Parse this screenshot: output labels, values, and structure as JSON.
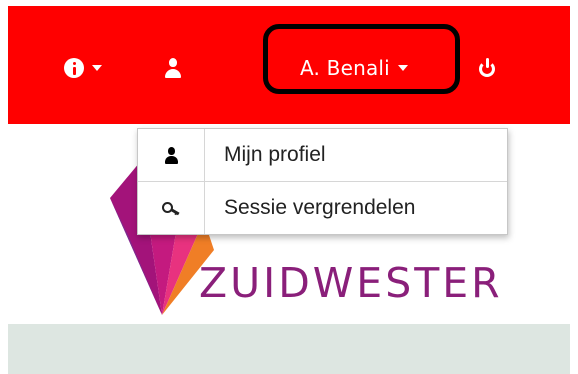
{
  "navbar": {
    "background": "#ff0000",
    "info_icon": "info-circle-icon",
    "user_icon": "user-icon",
    "account_name": "A. Benali",
    "power_icon": "power-icon"
  },
  "highlight": {
    "color": "#000000",
    "target": "account-menu"
  },
  "account_dropdown": {
    "items": [
      {
        "icon": "user-icon",
        "label": "Mijn profiel"
      },
      {
        "icon": "key-icon",
        "label": "Sessie vergrendelen"
      }
    ]
  },
  "logo": {
    "text": "ZUIDWESTER",
    "text_color": "#8a1f7a",
    "accent_colors": [
      "#c0157f",
      "#e8327f",
      "#7e2a8f",
      "#f07e26"
    ]
  },
  "bottom_band": {
    "color": "#dde6e1"
  }
}
